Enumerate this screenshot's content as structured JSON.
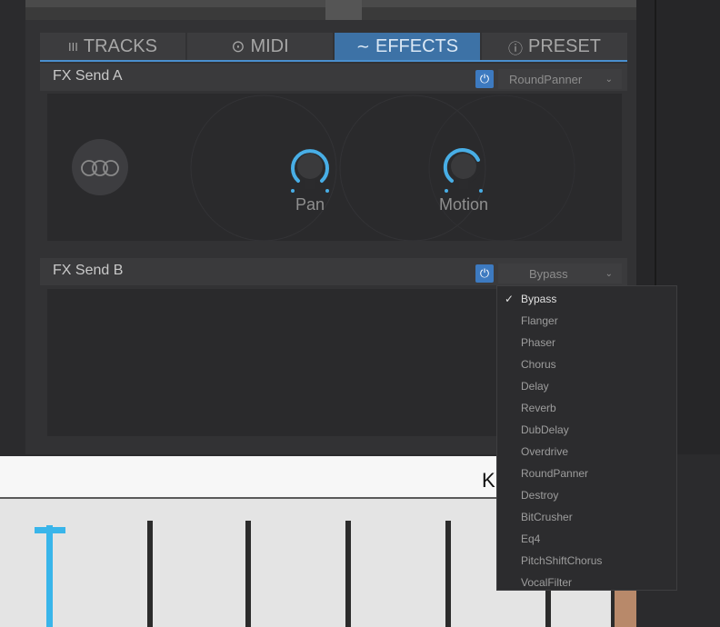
{
  "tabs": [
    {
      "icon": "tracks-icon",
      "glyph": "III",
      "label": "TRACKS",
      "active": false
    },
    {
      "icon": "midi-icon",
      "glyph": "⊙",
      "label": "MIDI",
      "active": false
    },
    {
      "icon": "effects-icon",
      "glyph": "∼",
      "label": "EFFECTS",
      "active": true
    },
    {
      "icon": "preset-icon",
      "glyph": "ⓘ",
      "label": "PRESET",
      "active": false
    }
  ],
  "fx_a": {
    "title": "FX Send A",
    "power_glyph": "⏻",
    "effect": "RoundPanner",
    "knobs": [
      {
        "label": "Pan"
      },
      {
        "label": "Motion"
      }
    ]
  },
  "fx_b": {
    "title": "FX Send B",
    "power_glyph": "⏻",
    "effect": "Bypass"
  },
  "dropdown": {
    "selected": "Bypass",
    "check": "✓",
    "options": [
      "Bypass",
      "Flanger",
      "Phaser",
      "Chorus",
      "Delay",
      "Reverb",
      "DubDelay",
      "Overdrive",
      "RoundPanner",
      "Destroy",
      "BitCrusher",
      "Eq4",
      "PitchShiftChorus",
      "VocalFilter"
    ]
  },
  "bottom": {
    "label": "K"
  },
  "colors": {
    "accent": "#3d72a6",
    "knob_arc": "#48aee6",
    "fader_active": "#39b5ea"
  }
}
